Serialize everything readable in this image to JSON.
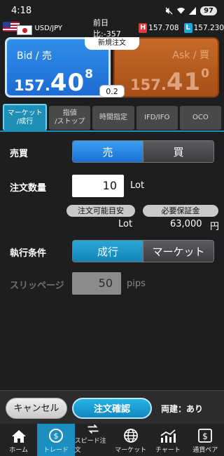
{
  "status_bar": {
    "time": "4:18",
    "icons": [
      "mute-icon",
      "wifi-icon",
      "signal-icon"
    ],
    "battery": "97"
  },
  "pair": {
    "name": "USD/JPY",
    "diff_label": "前日比:",
    "diff_value": "-357",
    "high_tag": "H",
    "high": "157.708",
    "low_tag": "L",
    "low": "157.230"
  },
  "price": {
    "new_order_label": "新規注文",
    "bid": {
      "label": "Bid / 売",
      "small": "157.",
      "big": "40",
      "sup": "8"
    },
    "ask": {
      "label": "Ask / 買",
      "small": "157.",
      "big": "41",
      "sup": "0"
    },
    "spread": "0.2"
  },
  "tabs": [
    {
      "label": "マーケット\n/成行",
      "active": true
    },
    {
      "label": "指値\n/ストップ",
      "active": false
    },
    {
      "label": "時間指定",
      "active": false
    },
    {
      "label": "IFD/IFO",
      "active": false
    },
    {
      "label": "OCO",
      "active": false
    }
  ],
  "form": {
    "side_label": "売買",
    "sell": "売",
    "buy": "買",
    "qty_label": "注文数量",
    "qty_value": "10",
    "qty_unit": "Lot",
    "avail_label": "注文可能目安",
    "avail_unit": "Lot",
    "margin_label": "必要保証金",
    "margin_value": "63,000",
    "margin_unit": "円",
    "exec_label": "執行条件",
    "exec_market_order": "成行",
    "exec_market": "マーケット",
    "slip_label": "スリッページ",
    "slip_value": "50",
    "slip_unit": "pips"
  },
  "actions": {
    "cancel": "キャンセル",
    "confirm": "注文確認",
    "both": "両建：あり"
  },
  "nav": [
    {
      "label": "ホーム",
      "icon": "home-icon",
      "active": false
    },
    {
      "label": "トレード",
      "icon": "trade-icon",
      "active": true
    },
    {
      "label": "スピード注文",
      "icon": "speed-order-icon",
      "active": false
    },
    {
      "label": "マーケット",
      "icon": "globe-icon",
      "active": false
    },
    {
      "label": "チャート",
      "icon": "chart-icon",
      "active": false
    },
    {
      "label": "通貨ペア",
      "icon": "currency-pair-icon",
      "active": false
    }
  ]
}
